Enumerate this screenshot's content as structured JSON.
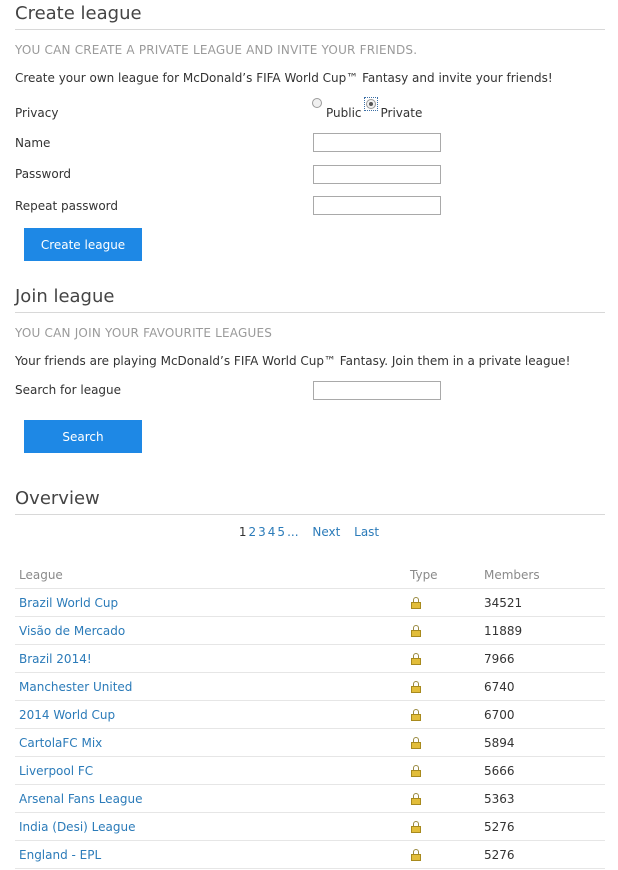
{
  "create": {
    "title": "Create league",
    "subtitle": "YOU CAN CREATE A PRIVATE LEAGUE AND INVITE YOUR FRIENDS.",
    "description": "Create your own league for McDonald’s FIFA World Cup™ Fantasy and invite your friends!",
    "privacy_label": "Privacy",
    "public_label": "Public",
    "private_label": "Private",
    "selected_privacy": "Private",
    "name_label": "Name",
    "name_value": "",
    "password_label": "Password",
    "password_value": "",
    "repeat_password_label": "Repeat password",
    "repeat_password_value": "",
    "button_label": "Create league"
  },
  "join": {
    "title": "Join league",
    "subtitle": "YOU CAN JOIN YOUR FAVOURITE LEAGUES",
    "description": "Your friends are playing McDonald’s FIFA World Cup™ Fantasy. Join them in a private league!",
    "search_label": "Search for league",
    "search_value": "",
    "button_label": "Search"
  },
  "overview": {
    "title": "Overview",
    "pager": {
      "current": "1",
      "pages": [
        "2",
        "3",
        "4",
        "5"
      ],
      "ellipsis": "...",
      "next": "Next",
      "last": "Last"
    },
    "columns": {
      "league": "League",
      "type": "Type",
      "members": "Members"
    },
    "rows": [
      {
        "league": "Brazil World Cup",
        "type": "lock-icon",
        "members": "34521"
      },
      {
        "league": "Visão de Mercado",
        "type": "lock-icon",
        "members": "11889"
      },
      {
        "league": "Brazil 2014!",
        "type": "lock-icon",
        "members": "7966"
      },
      {
        "league": "Manchester United",
        "type": "lock-icon",
        "members": "6740"
      },
      {
        "league": "2014 World Cup",
        "type": "lock-icon",
        "members": "6700"
      },
      {
        "league": "CartolaFC Mix",
        "type": "lock-icon",
        "members": "5894"
      },
      {
        "league": "Liverpool FC",
        "type": "lock-icon",
        "members": "5666"
      },
      {
        "league": "Arsenal Fans League",
        "type": "lock-icon",
        "members": "5363"
      },
      {
        "league": "India (Desi) League",
        "type": "lock-icon",
        "members": "5276"
      },
      {
        "league": "England - EPL",
        "type": "lock-icon",
        "members": "5276"
      }
    ]
  },
  "colors": {
    "button_bg": "#1e88e5",
    "link": "#2b7bb9",
    "subtitle": "#9a9a9a",
    "lock": "#e2bd3a"
  }
}
